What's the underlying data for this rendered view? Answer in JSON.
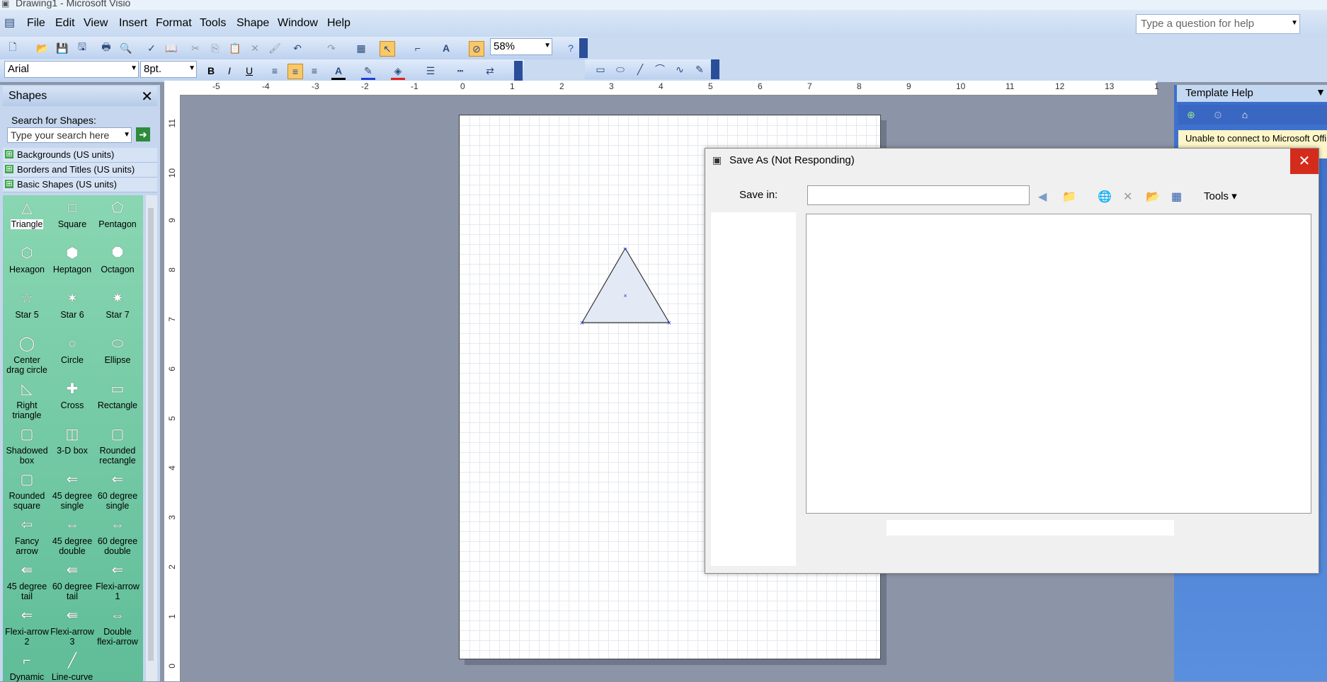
{
  "app": {
    "title": "Drawing1 - Microsoft Visio"
  },
  "menu": [
    "File",
    "Edit",
    "View",
    "Insert",
    "Format",
    "Tools",
    "Shape",
    "Window",
    "Help"
  ],
  "help_search": {
    "placeholder": "Type a question for help"
  },
  "toolbar": {
    "zoom": "58%",
    "font": "Arial",
    "font_size": "8pt."
  },
  "shapes_panel": {
    "title": "Shapes",
    "search_label": "Search for Shapes:",
    "search_placeholder": "Type your search here",
    "stencils": [
      "Backgrounds (US units)",
      "Borders and Titles (US units)",
      "Basic Shapes (US units)"
    ],
    "items": [
      "Triangle",
      "Square",
      "Pentagon",
      "Hexagon",
      "Heptagon",
      "Octagon",
      "Star 5",
      "Star 6",
      "Star 7",
      "Center drag circle",
      "Circle",
      "Ellipse",
      "Right triangle",
      "Cross",
      "Rectangle",
      "Shadowed box",
      "3-D box",
      "Rounded rectangle",
      "Rounded square",
      "45 degree single",
      "60 degree single",
      "Fancy arrow",
      "45 degree double",
      "60 degree double",
      "45 degree tail",
      "60 degree tail",
      "Flexi-arrow 1",
      "Flexi-arrow 2",
      "Flexi-arrow 3",
      "Double flexi-arrow",
      "Dynamic",
      "Line-curve"
    ]
  },
  "ruler": {
    "top": [
      "-5",
      "-4",
      "-3",
      "-2",
      "-1",
      "0",
      "1",
      "2",
      "3",
      "4",
      "5",
      "6",
      "7",
      "8",
      "9",
      "10",
      "11",
      "12",
      "13",
      "1"
    ],
    "left": [
      "11",
      "10",
      "9",
      "8",
      "7",
      "6",
      "5",
      "4",
      "3",
      "2",
      "1",
      "0"
    ]
  },
  "template_help": {
    "title": "Template Help",
    "message": "Unable to connect to Microsoft Offi"
  },
  "dialog": {
    "title": "Save As (Not Responding)",
    "save_in_label": "Save in:",
    "tools_label": "Tools"
  }
}
